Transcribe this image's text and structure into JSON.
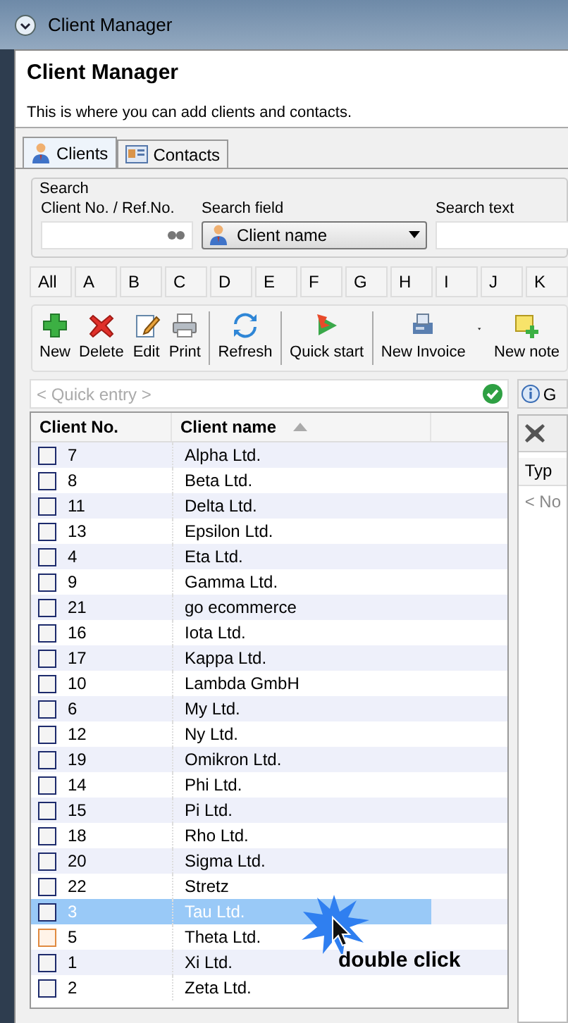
{
  "window": {
    "title": "Client Manager"
  },
  "header": {
    "title": "Client Manager",
    "subtitle": "This is where you can add clients and contacts."
  },
  "tabs": [
    {
      "label": "Clients",
      "selected": true
    },
    {
      "label": "Contacts",
      "selected": false
    }
  ],
  "search": {
    "group_label": "Search",
    "fields": [
      {
        "label": "Client No. / Ref.No.",
        "kind": "lookup"
      },
      {
        "label": "Search field",
        "kind": "select",
        "value": "Client name"
      },
      {
        "label": "Search text",
        "kind": "text"
      }
    ]
  },
  "letters": [
    "All",
    "A",
    "B",
    "C",
    "D",
    "E",
    "F",
    "G",
    "H",
    "I",
    "J",
    "K"
  ],
  "toolbar_groups": [
    [
      {
        "label": "New",
        "dropdown": false
      },
      {
        "label": "Delete",
        "dropdown": false
      },
      {
        "label": "Edit",
        "dropdown": false
      },
      {
        "label": "Print",
        "dropdown": false
      }
    ],
    [
      {
        "label": "Refresh",
        "dropdown": false
      }
    ],
    [
      {
        "label": "Quick start",
        "dropdown": false
      }
    ],
    [
      {
        "label": "New Invoice",
        "dropdown": true
      },
      {
        "label": "New note",
        "dropdown": false
      }
    ]
  ],
  "quick_entry": {
    "placeholder": "< Quick entry >"
  },
  "grid": {
    "columns": [
      {
        "label": "Client No.",
        "sorted": false
      },
      {
        "label": "Client name",
        "sorted": true
      }
    ],
    "rows": [
      {
        "number": "7",
        "name": "Alpha Ltd.",
        "selected": false,
        "hovered": false
      },
      {
        "number": "8",
        "name": "Beta Ltd.",
        "selected": false,
        "hovered": false
      },
      {
        "number": "11",
        "name": "Delta Ltd.",
        "selected": false,
        "hovered": false
      },
      {
        "number": "13",
        "name": "Epsilon Ltd.",
        "selected": false,
        "hovered": false
      },
      {
        "number": "4",
        "name": "Eta Ltd.",
        "selected": false,
        "hovered": false
      },
      {
        "number": "9",
        "name": "Gamma Ltd.",
        "selected": false,
        "hovered": false
      },
      {
        "number": "21",
        "name": "go ecommerce",
        "selected": false,
        "hovered": false
      },
      {
        "number": "16",
        "name": "Iota Ltd.",
        "selected": false,
        "hovered": false
      },
      {
        "number": "17",
        "name": "Kappa Ltd.",
        "selected": false,
        "hovered": false
      },
      {
        "number": "10",
        "name": "Lambda GmbH",
        "selected": false,
        "hovered": false
      },
      {
        "number": "6",
        "name": "My Ltd.",
        "selected": false,
        "hovered": false
      },
      {
        "number": "12",
        "name": "Ny Ltd.",
        "selected": false,
        "hovered": false
      },
      {
        "number": "19",
        "name": "Omikron Ltd.",
        "selected": false,
        "hovered": false
      },
      {
        "number": "14",
        "name": "Phi Ltd.",
        "selected": false,
        "hovered": false
      },
      {
        "number": "15",
        "name": "Pi Ltd.",
        "selected": false,
        "hovered": false
      },
      {
        "number": "18",
        "name": "Rho Ltd.",
        "selected": false,
        "hovered": false
      },
      {
        "number": "20",
        "name": "Sigma Ltd.",
        "selected": false,
        "hovered": false
      },
      {
        "number": "22",
        "name": "Stretz",
        "selected": false,
        "hovered": false
      },
      {
        "number": "3",
        "name": "Tau Ltd.",
        "selected": true,
        "hovered": false
      },
      {
        "number": "5",
        "name": "Theta Ltd.",
        "selected": false,
        "hovered": true
      },
      {
        "number": "1",
        "name": "Xi Ltd.",
        "selected": false,
        "hovered": false
      },
      {
        "number": "2",
        "name": "Zeta Ltd.",
        "selected": false,
        "hovered": false
      }
    ]
  },
  "side_panel": {
    "tab": "G",
    "column": "Typ",
    "empty_text": "< No"
  },
  "annotation": {
    "text": "double click"
  }
}
